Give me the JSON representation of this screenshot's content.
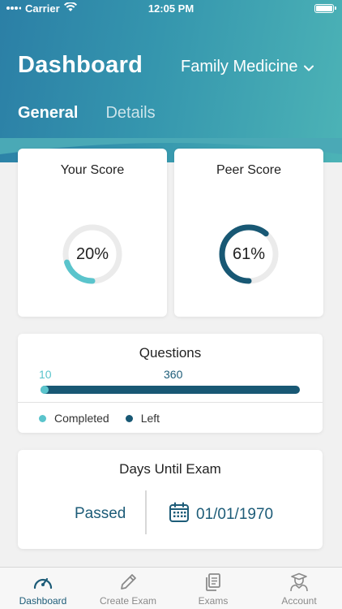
{
  "status": {
    "carrier": "Carrier",
    "time": "12:05 PM"
  },
  "header": {
    "title": "Dashboard",
    "specialty": "Family Medicine",
    "tabs": [
      {
        "label": "General",
        "active": true
      },
      {
        "label": "Details",
        "active": false
      }
    ]
  },
  "scores": {
    "your": {
      "title": "Your Score",
      "label": "20%",
      "value": 20
    },
    "peer": {
      "title": "Peer Score",
      "label": "61%",
      "value": 61
    }
  },
  "questions": {
    "title": "Questions",
    "completed": 10,
    "total": 360,
    "completed_label": "10",
    "total_label": "360",
    "legend_completed": "Completed",
    "legend_left": "Left"
  },
  "exam": {
    "title": "Days Until Exam",
    "status": "Passed",
    "date": "01/01/1970"
  },
  "tabbar": {
    "dashboard": "Dashboard",
    "create_exam": "Create Exam",
    "exams": "Exams",
    "account": "Account"
  },
  "colors": {
    "accent_light": "#5ac4cc",
    "accent_dark": "#185874",
    "ring_track": "#ebebeb"
  }
}
